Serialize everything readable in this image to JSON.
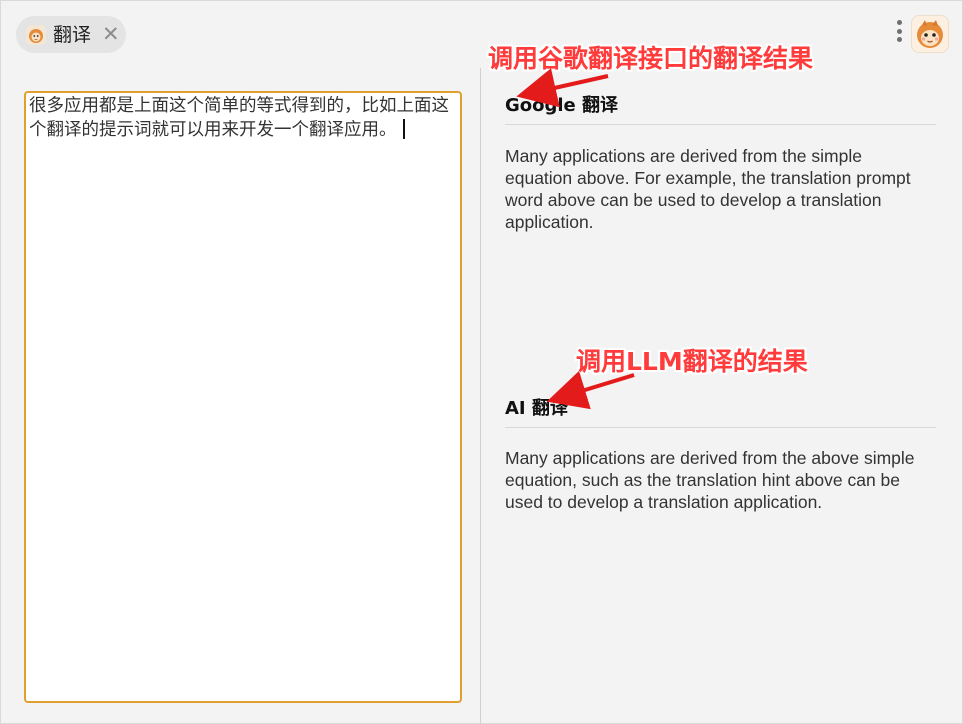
{
  "tab": {
    "label": "翻译",
    "icon": "monkey-avatar-icon",
    "close": "✕"
  },
  "header": {
    "more_icon": "more-vertical-icon",
    "avatar_icon": "monkey-avatar-icon"
  },
  "editor": {
    "text": "很多应用都是上面这个简单的等式得到的，比如上面这个翻译的提示词就可以用来开发一个翻译应用。"
  },
  "results": [
    {
      "title": "Google 翻译",
      "text": "Many applications are derived from the simple equation above. For example, the translation prompt word above can be used to develop a translation application."
    },
    {
      "title": "AI 翻译",
      "text": "Many applications are derived from the above simple equation, such as the translation hint above can be used to develop a translation application."
    }
  ],
  "annotations": [
    {
      "text": "调用谷歌翻译接口的翻译结果"
    },
    {
      "text": "调用LLM翻译的结果"
    }
  ],
  "colors": {
    "accent": "#e0a030",
    "annotation": "#ff3b3b",
    "background": "#f3f3f3"
  }
}
